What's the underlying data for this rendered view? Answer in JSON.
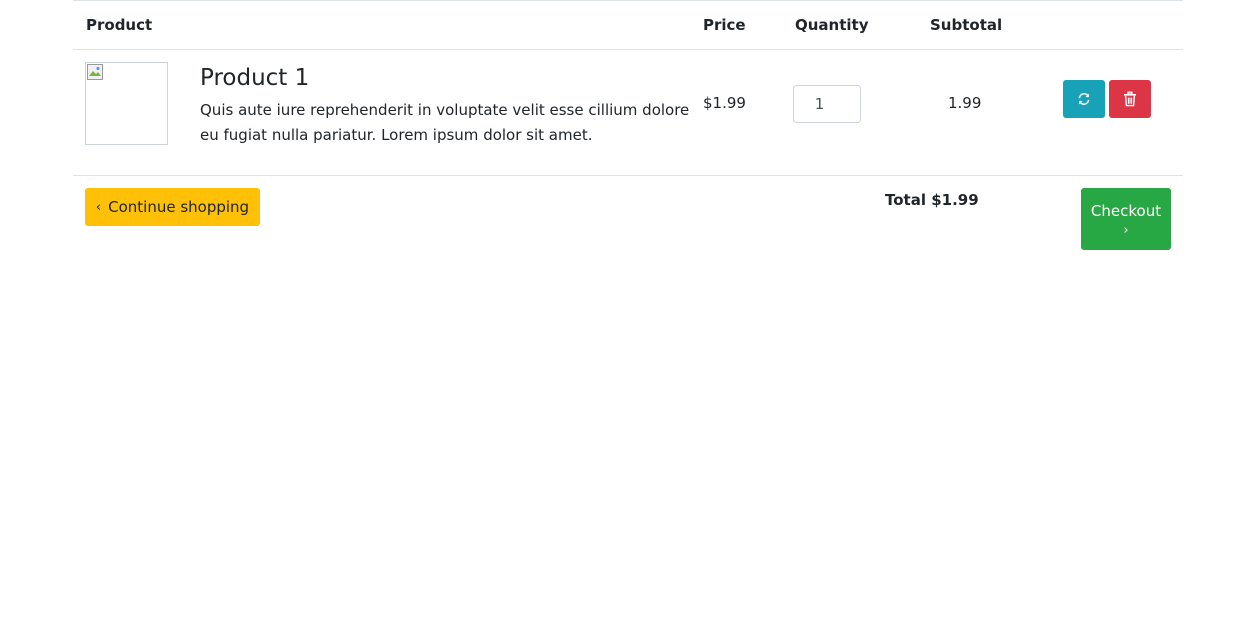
{
  "table": {
    "headers": {
      "product": "Product",
      "price": "Price",
      "quantity": "Quantity",
      "subtotal": "Subtotal"
    },
    "rows": [
      {
        "title": "Product 1",
        "description": "Quis aute iure reprehenderit in voluptate velit esse cillium dolore eu fugiat nulla pariatur. Lorem ipsum dolor sit amet.",
        "price": "$1.99",
        "quantity": "1",
        "subtotal": "1.99"
      }
    ]
  },
  "footer": {
    "continue_label": "Continue shopping",
    "continue_icon": "‹",
    "total_label": "Total $1.99",
    "checkout_label": "Checkout",
    "checkout_icon": "›"
  },
  "colors": {
    "refresh": "#17a2b8",
    "delete": "#dc3545",
    "continue": "#ffc107",
    "checkout": "#28a745",
    "border": "#dee2e6"
  },
  "icons": {
    "refresh_button": "refresh-icon",
    "delete_button": "trash-icon",
    "product_image": "broken-image-icon"
  }
}
